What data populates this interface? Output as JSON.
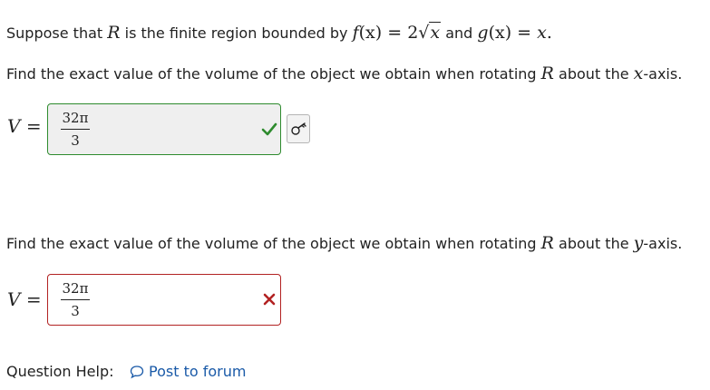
{
  "intro": {
    "text_prefix": "Suppose that ",
    "var_R": "R",
    "text_mid": " is the finite region bounded by ",
    "f_name": "f",
    "f_arg": "(x)",
    "eq": " = ",
    "f_coef": "2",
    "sqrt_symbol": "√",
    "f_radicand": "x",
    "text_and": " and ",
    "g_name": "g",
    "g_arg": "(x)",
    "g_rhs": "x",
    "period": "."
  },
  "part1": {
    "question_prefix": "Find the exact value of the volume of the object we obtain when rotating ",
    "var_R": "R",
    "question_suffix": " about the ",
    "axis": "x",
    "axis_suffix": "-axis.",
    "label_var": "V",
    "label_eq": "=",
    "answer_numerator": "32π",
    "answer_denominator": "3",
    "status": "correct"
  },
  "part2": {
    "question_prefix": "Find the exact value of the volume of the object we obtain when rotating ",
    "var_R": "R",
    "question_suffix": " about the ",
    "axis": "y",
    "axis_suffix": "-axis.",
    "label_var": "V",
    "label_eq": "=",
    "answer_numerator": "32π",
    "answer_denominator": "3",
    "status": "incorrect"
  },
  "help": {
    "label": "Question Help:",
    "forum_link": "Post to forum"
  },
  "icons": {
    "correct": "checkmark-icon",
    "incorrect": "x-mark-icon",
    "key": "key-icon",
    "forum": "speech-bubble-icon"
  },
  "colors": {
    "correct": "#2e8b2e",
    "incorrect": "#b22222",
    "link": "#1a5aa8"
  }
}
